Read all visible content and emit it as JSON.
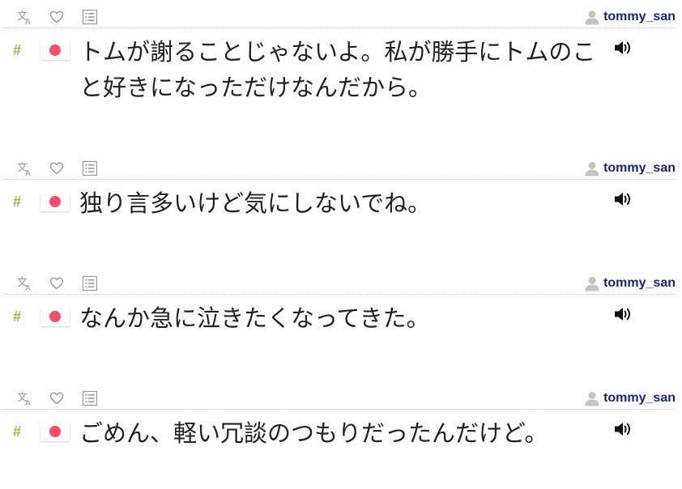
{
  "icons": {
    "translate": "translate-icon",
    "favorite": "heart-icon",
    "list": "list-icon",
    "user": "user-icon",
    "tag": "hash-icon",
    "language": "japan-flag-icon",
    "audio": "speaker-icon"
  },
  "colors": {
    "username": "#1a237e",
    "hash": "#8bc34a",
    "flag_dot": "#ff4a6c",
    "text": "#222222",
    "icon": "#9a9a9a"
  },
  "entries": [
    {
      "username": "tommy_san",
      "hash": "#",
      "text": "トムが謝ることじゃないよ。私が勝手にトムのこと好きになっただけなんだから。"
    },
    {
      "username": "tommy_san",
      "hash": "#",
      "text": "独り言多いけど気にしないでね。"
    },
    {
      "username": "tommy_san",
      "hash": "#",
      "text": "なんか急に泣きたくなってきた。"
    },
    {
      "username": "tommy_san",
      "hash": "#",
      "text": "ごめん、軽い冗談のつもりだったんだけど。"
    }
  ]
}
